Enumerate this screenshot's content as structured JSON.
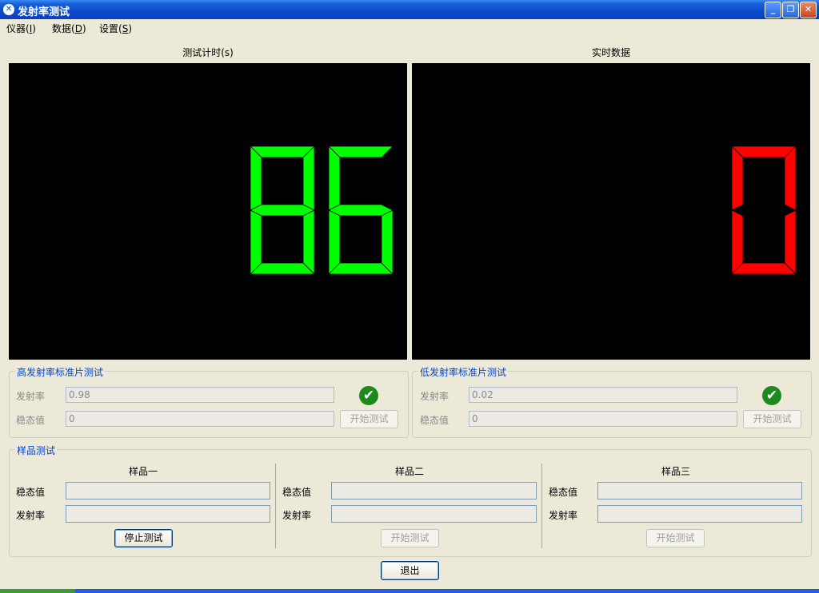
{
  "window": {
    "title": "发射率测试"
  },
  "menu": [
    {
      "label": "仪器",
      "key": "I"
    },
    {
      "label": "数据",
      "key": "D"
    },
    {
      "label": "设置",
      "key": "S"
    }
  ],
  "timer_panel": {
    "label": "测试计时(s)",
    "value": "86",
    "color": "#00ff00"
  },
  "realtime_panel": {
    "label": "实时数据",
    "value": "0",
    "color": "#ff0000"
  },
  "high_std": {
    "title": "高发射率标准片测试",
    "emissivity_label": "发射率",
    "emissivity_value": "0.98",
    "steady_label": "稳态值",
    "steady_value": "0",
    "status_icon": "check-circle-icon",
    "button": "开始测试"
  },
  "low_std": {
    "title": "低发射率标准片测试",
    "emissivity_label": "发射率",
    "emissivity_value": "0.02",
    "steady_label": "稳态值",
    "steady_value": "0",
    "status_icon": "check-circle-icon",
    "button": "开始测试"
  },
  "sample_group": {
    "title": "样品测试",
    "samples": [
      {
        "title": "样品一",
        "steady_label": "稳态值",
        "emissivity_label": "发射率",
        "button": "停止测试"
      },
      {
        "title": "样品二",
        "steady_label": "稳态值",
        "emissivity_label": "发射率",
        "button": "开始测试"
      },
      {
        "title": "样品三",
        "steady_label": "稳态值",
        "emissivity_label": "发射率",
        "button": "开始测试"
      }
    ]
  },
  "exit_button": "退出",
  "colors": {
    "accent": "#0046d5",
    "titlebar": "#0a4ccf"
  }
}
